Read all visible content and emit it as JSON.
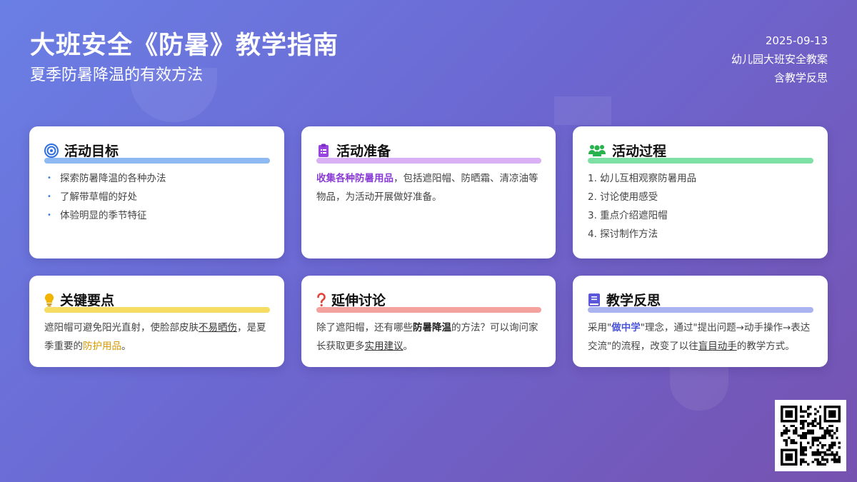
{
  "header": {
    "title": "大班安全《防暑》教学指南",
    "subtitle": "夏季防暑降温的有效方法",
    "date": "2025-09-13",
    "meta1": "幼儿园大班安全教案",
    "meta2": "含教学反思"
  },
  "colors": {
    "goal_bar": "#8fb9f2",
    "prep_bar": "#d8b0f3",
    "process_bar": "#7fe0a6",
    "key_bar": "#f6dc62",
    "discuss_bar": "#f4a29d",
    "reflect_bar": "#a9b4f1"
  },
  "cards": {
    "goal": {
      "title": "活动目标",
      "icon": "target-icon",
      "items": [
        "探索防暑降温的各种办法",
        "了解带草帽的好处",
        "体验明显的季节特征"
      ]
    },
    "prep": {
      "title": "活动准备",
      "icon": "clipboard-icon",
      "highlight": "收集各种防暑用品",
      "text": "，包括遮阳帽、防晒霜、清凉油等物品，为活动开展做好准备。"
    },
    "process": {
      "title": "活动过程",
      "icon": "users-icon",
      "steps": [
        "1. 幼儿互相观察防暑用品",
        "2. 讨论使用感受",
        "3. 重点介绍遮阳帽",
        "4. 探讨制作方法"
      ]
    },
    "key": {
      "title": "关键要点",
      "icon": "lightbulb-icon",
      "t1": "遮阳帽可避免阳光直射，使脸部皮肤",
      "u1": "不易晒伤",
      "t2": "，是夏季重要的",
      "h1": "防护用品",
      "t3": "。"
    },
    "discuss": {
      "title": "延伸讨论",
      "icon": "question-icon",
      "t1": "除了遮阳帽，还有哪些",
      "b1": "防暑降温",
      "t2": "的方法？可以询问家长获取更多",
      "u1": "实用建议",
      "t3": "。"
    },
    "reflect": {
      "title": "教学反思",
      "icon": "book-icon",
      "t1": "采用\"",
      "h1": "做中学",
      "t2": "\"理念，通过\"提出问题→动手操作→表达交流\"的流程，改变了以往",
      "u1": "盲目动手",
      "t3": "的教学方式。"
    }
  },
  "qr": {
    "icon": "qr-code-icon"
  }
}
